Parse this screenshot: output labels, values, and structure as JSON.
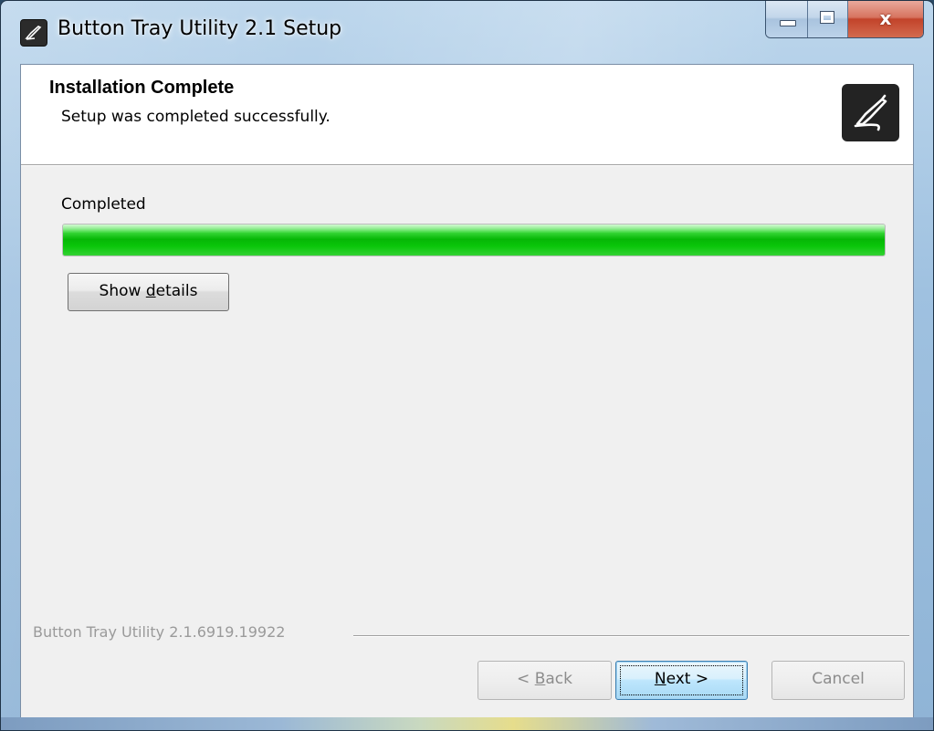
{
  "window": {
    "title": "Button Tray Utility 2.1 Setup",
    "caption_buttons": {
      "minimize_icon": "minimize-icon",
      "maximize_icon": "maximize-icon",
      "close_glyph": "x"
    }
  },
  "header": {
    "title": "Installation Complete",
    "subtitle": "Setup was completed successfully.",
    "logo_icon": "pen-stylus-icon"
  },
  "progress": {
    "label": "Completed",
    "value_percent": 100,
    "fill_color": "#06b706"
  },
  "buttons": {
    "show_details": {
      "pre": "Show ",
      "accel": "d",
      "post": "etails"
    },
    "back": {
      "pre": "< ",
      "accel": "B",
      "post": "ack"
    },
    "next": {
      "pre": "",
      "accel": "N",
      "post": "ext >"
    },
    "cancel": "Cancel"
  },
  "branding": "Button Tray Utility 2.1.6919.19922"
}
